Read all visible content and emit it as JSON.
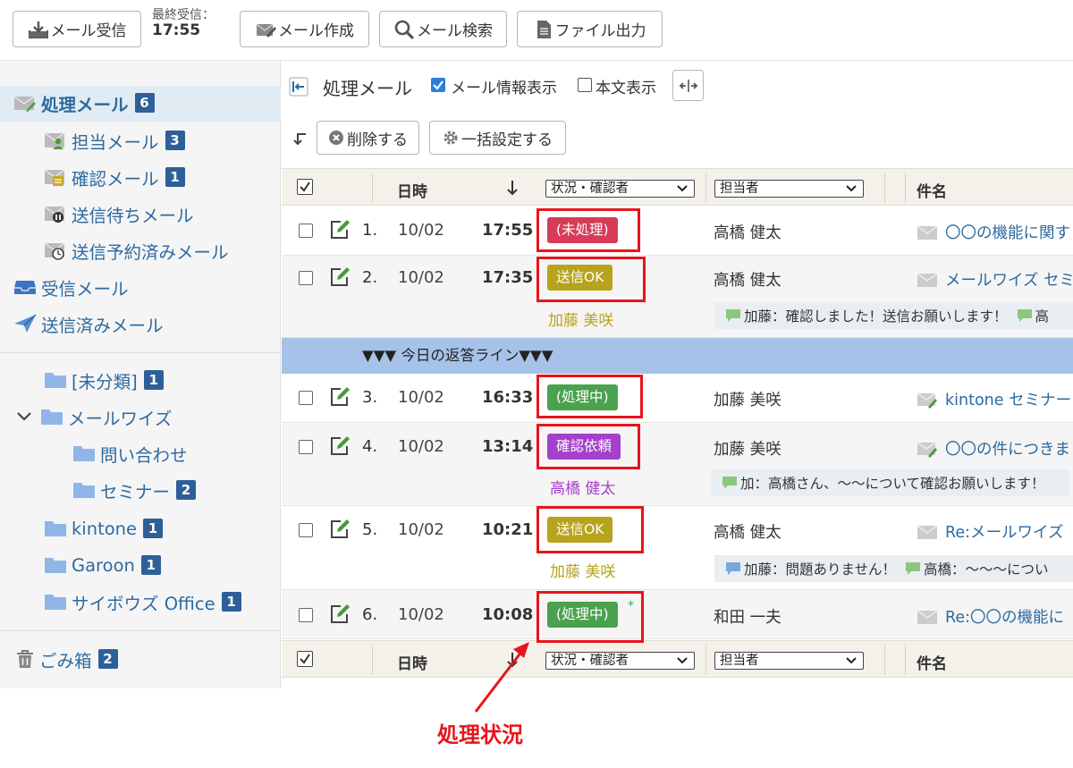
{
  "toolbar": {
    "receive_label": "メール受信",
    "last_recv_label": "最終受信：",
    "last_recv_time": "17:55",
    "compose_label": "メール作成",
    "search_label": "メール検索",
    "export_label": "ファイル出力"
  },
  "sidebar": {
    "items": [
      {
        "label": "処理メール",
        "count": "6"
      },
      {
        "label": "担当メール",
        "count": "3"
      },
      {
        "label": "確認メール",
        "count": "1"
      },
      {
        "label": "送信待ちメール"
      },
      {
        "label": "送信予約済みメール"
      },
      {
        "label": "受信メール"
      },
      {
        "label": "送信済みメール"
      }
    ],
    "folders": [
      {
        "label": "[未分類]",
        "count": "1"
      },
      {
        "label": "メールワイズ"
      },
      {
        "label": "問い合わせ"
      },
      {
        "label": "セミナー",
        "count": "2"
      },
      {
        "label": "kintone",
        "count": "1"
      },
      {
        "label": "Garoon",
        "count": "1"
      },
      {
        "label": "サイボウズ Office",
        "count": "1"
      }
    ],
    "trash": {
      "label": "ごみ箱",
      "count": "2"
    }
  },
  "main": {
    "title": "処理メール",
    "show_info_label": "メール情報表示",
    "show_body_label": "本文表示",
    "delete_label": "削除する",
    "bulk_label": "一括設定する"
  },
  "columns": {
    "date": "日時",
    "status": "状況・確認者",
    "assignee": "担当者",
    "subject": "件名"
  },
  "rows": [
    {
      "num": "1.",
      "date": "10/02",
      "time": "17:55",
      "status": "(未処理)",
      "status_color": "#d63c58",
      "assignee": "高橋 健太",
      "subject": "〇〇の機能に関す"
    },
    {
      "num": "2.",
      "date": "10/02",
      "time": "17:35",
      "status": "送信OK",
      "status_color": "#b8a41c",
      "assignee": "高橋 健太",
      "subject": "メールワイズ セミ",
      "confirmer": "加藤 美咲",
      "comment1": "加藤：確認しました！送信お願いします！",
      "comment2": "高"
    },
    {
      "num": "3.",
      "date": "10/02",
      "time": "16:33",
      "status": "(処理中)",
      "status_color": "#4aa24e",
      "assignee": "加藤 美咲",
      "subject": "kintone セミナー"
    },
    {
      "num": "4.",
      "date": "10/02",
      "time": "13:14",
      "status": "確認依頼",
      "status_color": "#a53fcc",
      "assignee": "加藤 美咲",
      "subject": "〇〇の件につきま",
      "confirmer": "高橋 健太",
      "comment1": "加：高橋さん、〜〜について確認お願いします！"
    },
    {
      "num": "5.",
      "date": "10/02",
      "time": "10:21",
      "status": "送信OK",
      "status_color": "#b8a41c",
      "assignee": "高橋 健太",
      "subject": "Re:メールワイズ",
      "confirmer": "加藤 美咲",
      "comment1": "加藤：問題ありません！",
      "comment2": "高橋：〜〜〜につい"
    },
    {
      "num": "6.",
      "date": "10/02",
      "time": "10:08",
      "status": "(処理中)",
      "status_color": "#4aa24e",
      "assignee": "和田 一夫",
      "subject": "Re:〇〇の機能に",
      "mark": "*"
    }
  ],
  "today_line": "▼▼▼ 今日の返答ライン▼▼▼",
  "annotation": "処理状況",
  "colors": {
    "accent_red": "#e8141b",
    "link_blue": "#2d6aa0",
    "badge_blue": "#2e5f99"
  }
}
